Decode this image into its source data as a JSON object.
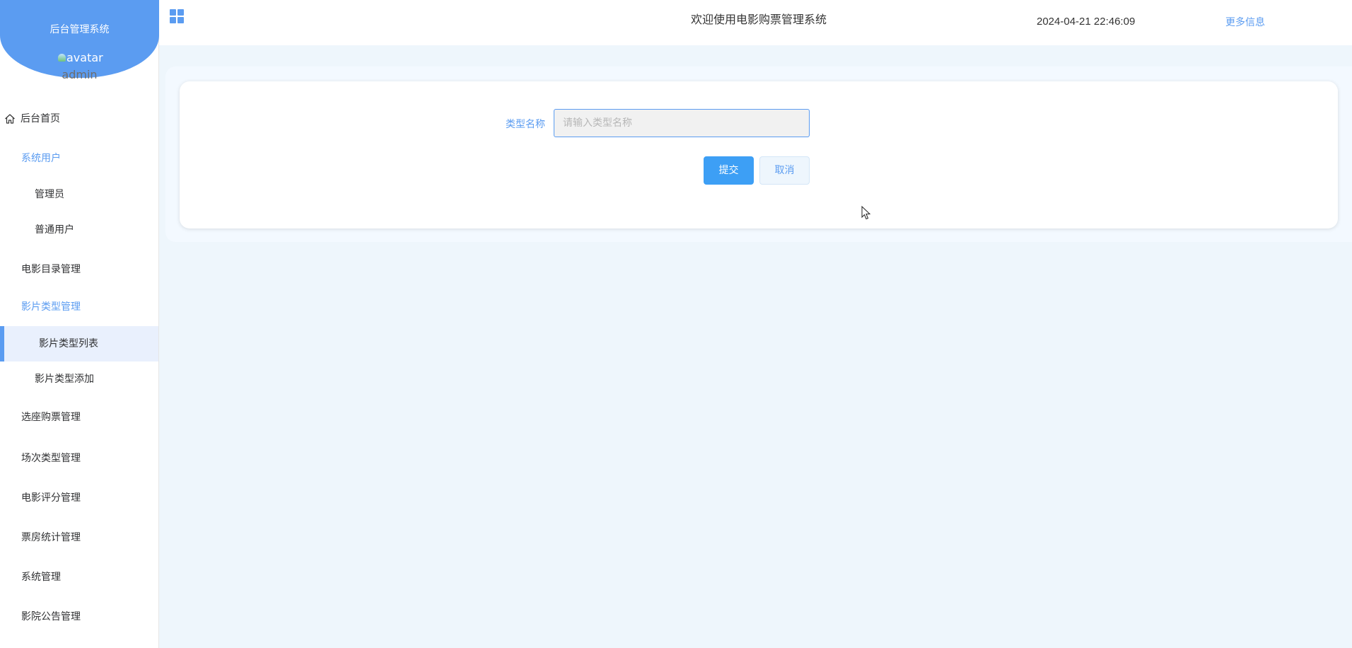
{
  "sidebar": {
    "brand_title": "后台管理系统",
    "avatar_alt": "avatar",
    "username": "admin",
    "items": [
      {
        "label": "后台首页"
      },
      {
        "label": "系统用户"
      },
      {
        "label": "管理员"
      },
      {
        "label": "普通用户"
      },
      {
        "label": "电影目录管理"
      },
      {
        "label": "影片类型管理"
      },
      {
        "label": "影片类型列表"
      },
      {
        "label": "影片类型添加"
      },
      {
        "label": "选座购票管理"
      },
      {
        "label": "场次类型管理"
      },
      {
        "label": "电影评分管理"
      },
      {
        "label": "票房统计管理"
      },
      {
        "label": "系统管理"
      },
      {
        "label": "影院公告管理"
      }
    ]
  },
  "header": {
    "title": "欢迎使用电影购票管理系统",
    "datetime": "2024-04-21 22:46:09",
    "more_info": "更多信息"
  },
  "form": {
    "type_name_label": "类型名称",
    "type_name_placeholder": "请输入类型名称",
    "type_name_value": "",
    "submit_label": "提交",
    "cancel_label": "取消"
  },
  "colors": {
    "accent": "#5b9cf1",
    "primary_button": "#3d9ff5",
    "background": "#eef6fc"
  },
  "icons": {
    "menu_toggle": "grid-icon",
    "home": "home-icon"
  }
}
